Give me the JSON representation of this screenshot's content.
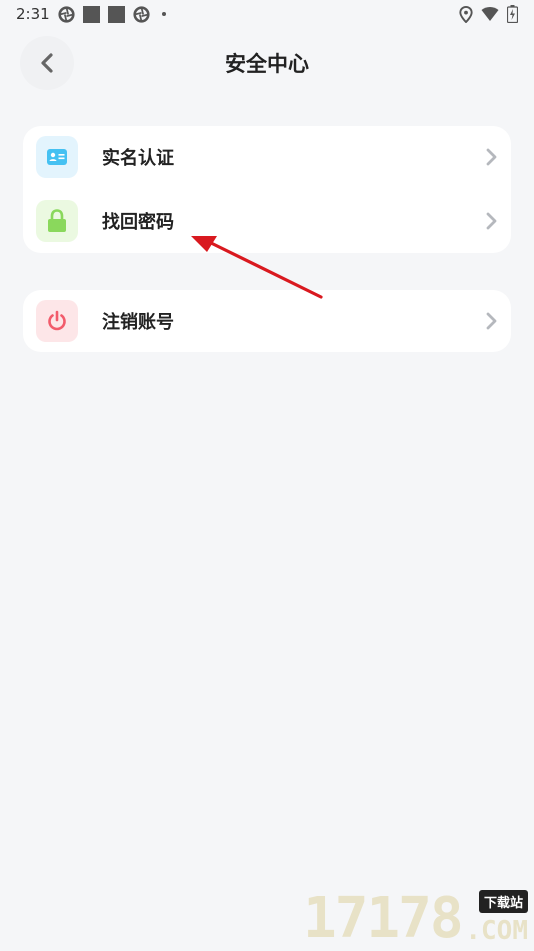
{
  "status_bar": {
    "time": "2:31"
  },
  "header": {
    "title": "安全中心"
  },
  "menu": {
    "group1": [
      {
        "label": "实名认证",
        "icon": "id-card-icon",
        "icon_bg": "#e3f4fd",
        "icon_color": "#45c1f2"
      },
      {
        "label": "找回密码",
        "icon": "lock-icon",
        "icon_bg": "#ebf9e1",
        "icon_color": "#8ad85c"
      }
    ],
    "group2": [
      {
        "label": "注销账号",
        "icon": "power-icon",
        "icon_bg": "#fde6e8",
        "icon_color": "#f25b6b"
      }
    ]
  },
  "annotation": {
    "arrow_color": "#d9191f"
  },
  "watermark": {
    "number": "17178",
    "tag": "下载站",
    "suffix": ".COM"
  }
}
